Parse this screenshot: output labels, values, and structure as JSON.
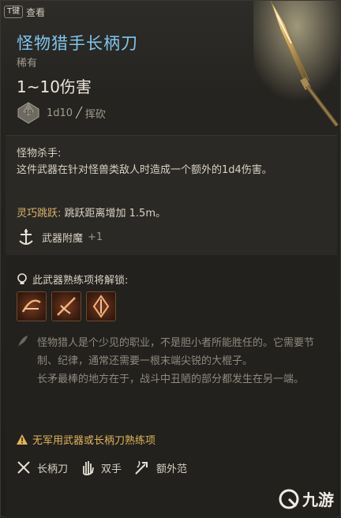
{
  "hint": {
    "key": "T键",
    "label": "查看"
  },
  "item": {
    "name": "怪物猎手长柄刀",
    "rarity": "稀有",
    "damage": "1~10伤害",
    "dice": "1d10",
    "damage_type": "挥砍"
  },
  "passive": {
    "title": "怪物杀手:",
    "description": "这件武器在针对怪兽类敌人时造成一个额外的1d4伤害。",
    "agility_label": "灵巧跳跃:",
    "agility_text": " 跳跃距离增加 1.5m。",
    "enchant_label": "武器附魔",
    "enchant_value": "+1"
  },
  "proficiency": {
    "unlock_text": "此武器熟练项将解锁:",
    "skills": [
      "skill-1",
      "skill-2",
      "skill-3"
    ]
  },
  "flavor": {
    "line1": "怪物猎人是个少见的职业，不是胆小者所能胜任的。它需要节制、纪律，通常还需要一根末端尖锐的大棍子。",
    "line2": "长矛最棒的地方在于，战斗中丑陋的部分都发生在另一端。"
  },
  "warning": "无军用武器或长柄刀熟练项",
  "properties": [
    {
      "icon": "crossed-blades-icon",
      "label": "长柄刀"
    },
    {
      "icon": "hand-icon",
      "label": "双手"
    },
    {
      "icon": "reach-icon",
      "label": "额外范"
    }
  ],
  "watermark": "九游",
  "colors": {
    "title": "#7fc6ef",
    "warning": "#e2b45b",
    "agility": "#d9b36b"
  }
}
